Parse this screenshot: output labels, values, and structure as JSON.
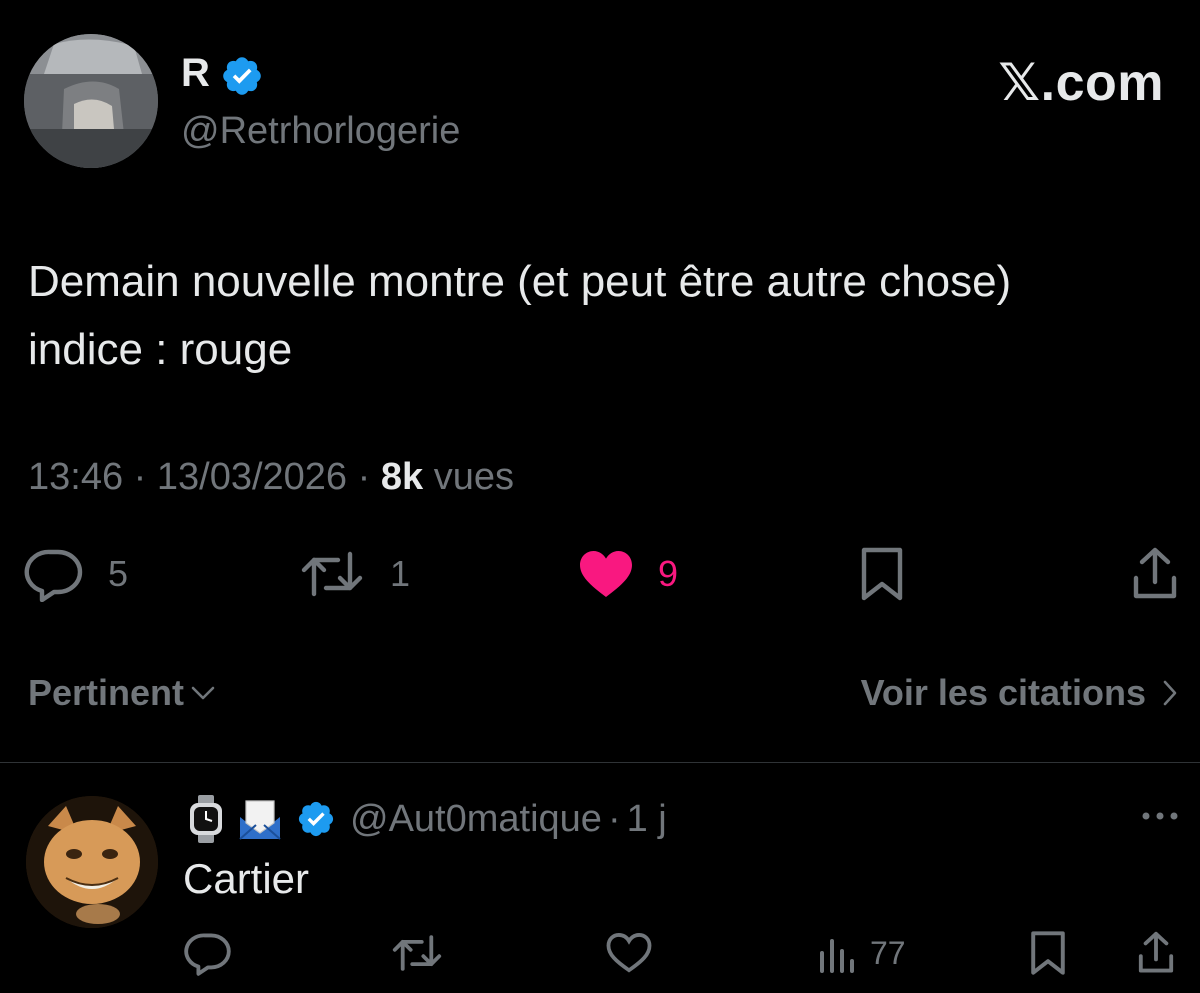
{
  "post": {
    "author_name": "R",
    "author_handle": "@Retrhorlogerie",
    "site_logo": "𝕏.com",
    "text_line1": "Demain nouvelle montre (et peut être autre chose)",
    "text_line2": "indice : rouge",
    "time": "13:46",
    "date": "13/03/2026",
    "views_count": "8k",
    "views_label": "vues",
    "separator": "·",
    "stats": {
      "replies": "5",
      "reposts": "1",
      "likes": "9"
    },
    "icons": {
      "verified": "verified-badge-icon",
      "reply": "comment-bubble-icon",
      "repost": "repost-icon",
      "like": "heart-icon",
      "bookmark": "bookmark-icon",
      "share": "share-icon"
    }
  },
  "replies_bar": {
    "sort_label": "Pertinent",
    "quotes_label": "Voir les citations"
  },
  "reply": {
    "handle": "@Aut0matique",
    "time_ago": "1 j",
    "text": "Cartier",
    "views": "77",
    "name_emojis": [
      "watch-icon",
      "envelope-icon"
    ]
  },
  "colors": {
    "background": "#000000",
    "text": "#e7e9ea",
    "muted": "#71767b",
    "like": "#f91880",
    "verified": "#1d9bf0",
    "divider": "#2f3336"
  }
}
